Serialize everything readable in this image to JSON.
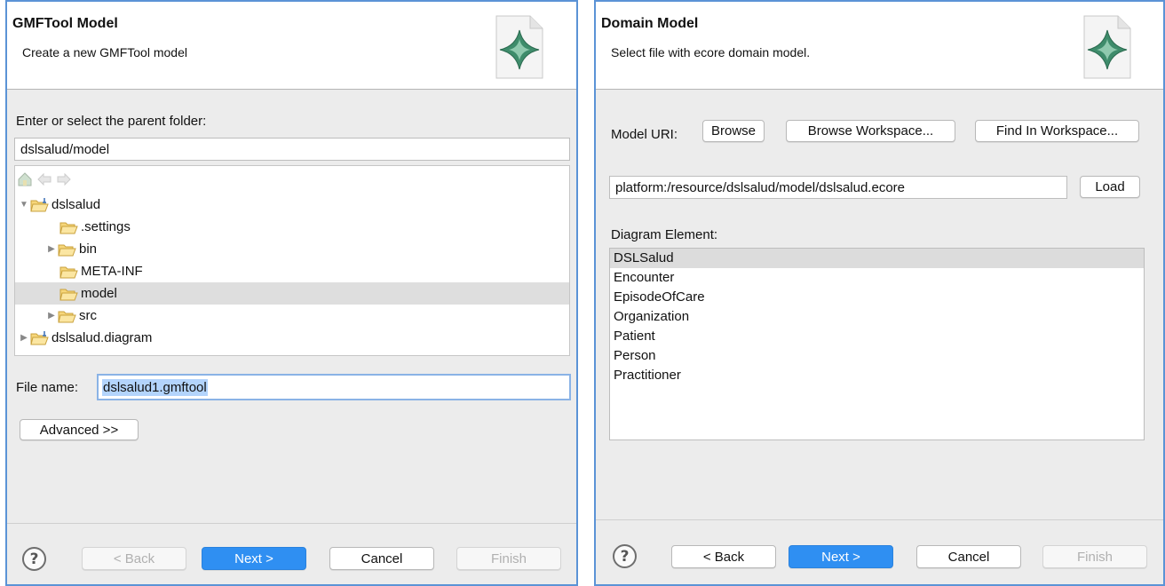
{
  "left": {
    "title": "GMFTool Model",
    "description": "Create a new GMFTool model",
    "parent_folder_label": "Enter or select the parent folder:",
    "parent_folder_value": "dslsalud/model",
    "tree": [
      {
        "label": "dslsalud",
        "expanded": true,
        "project": true
      },
      {
        "label": ".settings"
      },
      {
        "label": "bin",
        "collapsed": true
      },
      {
        "label": "META-INF"
      },
      {
        "label": "model",
        "selected": true
      },
      {
        "label": "src",
        "collapsed": true
      },
      {
        "label": "dslsalud.diagram",
        "collapsed": true,
        "project": true
      }
    ],
    "file_name_label": "File name:",
    "file_name_value": "dslsalud1.gmftool",
    "advanced_button": "Advanced >>",
    "buttons": {
      "back": "< Back",
      "next": "Next >",
      "cancel": "Cancel",
      "finish": "Finish"
    }
  },
  "right": {
    "title": "Domain Model",
    "description": "Select file with ecore domain model.",
    "model_uri_label": "Model URI:",
    "browse_button": "Browse",
    "browse_workspace_button": "Browse Workspace...",
    "find_in_workspace_button": "Find In Workspace...",
    "uri_value": "platform:/resource/dslsalud/model/dslsalud.ecore",
    "load_button": "Load",
    "diagram_element_label": "Diagram Element:",
    "elements": [
      "DSLSalud",
      "Encounter",
      "EpisodeOfCare",
      "Organization",
      "Patient",
      "Person",
      "Practitioner"
    ],
    "buttons": {
      "back": "< Back",
      "next": "Next >",
      "cancel": "Cancel",
      "finish": "Finish"
    }
  },
  "colors": {
    "accent": "#2f8ff2",
    "panel_border": "#5b93d6",
    "selection": "#dedede",
    "text_selection": "#b3d4fc"
  }
}
